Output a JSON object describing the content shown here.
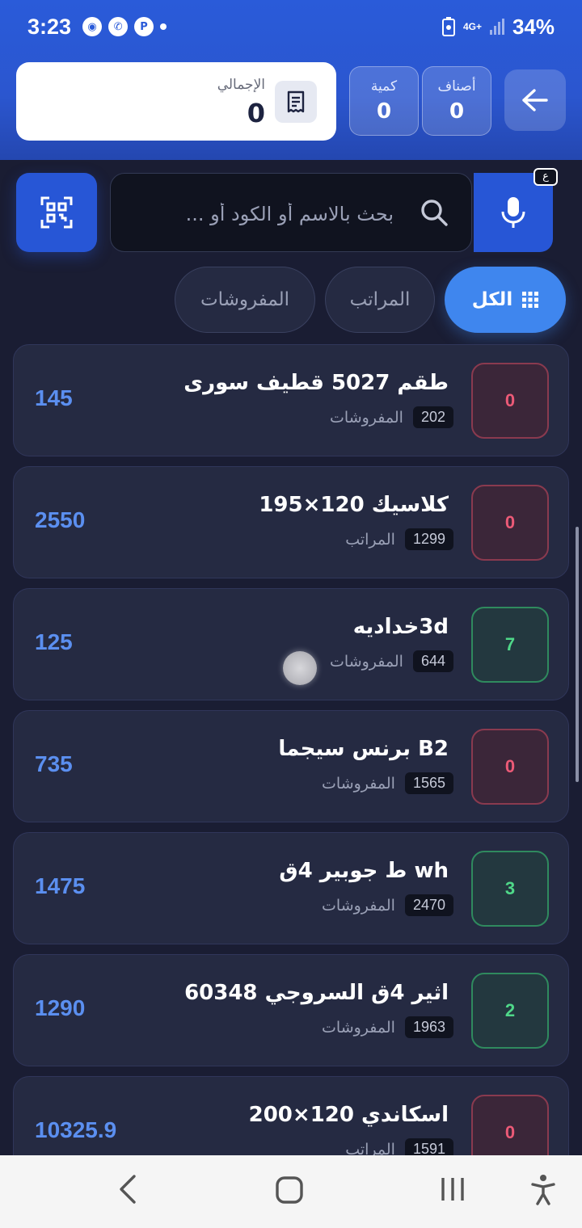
{
  "status_bar": {
    "time": "3:23",
    "network": "4G+",
    "battery": "34%"
  },
  "header": {
    "total_label": "الإجمالي",
    "total_value": "0",
    "quantity_label": "كمية",
    "quantity_value": "0",
    "items_label": "أصناف",
    "items_value": "0"
  },
  "search": {
    "placeholder": "بحث بالاسم أو الكود أو ...",
    "keyboard_badge": "ع"
  },
  "filters": [
    {
      "label": "الكل"
    },
    {
      "label": "المراتب"
    },
    {
      "label": "المفروشات"
    }
  ],
  "products": [
    {
      "name": "طقم 5027 قطيف سورى",
      "code": "202",
      "category": "المفروشات",
      "quantity": "0",
      "price": "145"
    },
    {
      "name": "كلاسيك 120×195",
      "code": "1299",
      "category": "المراتب",
      "quantity": "0",
      "price": "2550"
    },
    {
      "name": "3dخداديه",
      "code": "644",
      "category": "المفروشات",
      "quantity": "7",
      "price": "125"
    },
    {
      "name": "B2 برنس سيجما",
      "code": "1565",
      "category": "المفروشات",
      "quantity": "0",
      "price": "735"
    },
    {
      "name": "wh ط جوبير 4ق",
      "code": "2470",
      "category": "المفروشات",
      "quantity": "3",
      "price": "1475"
    },
    {
      "name": "اثير 4ق السروجي 60348",
      "code": "1963",
      "category": "المفروشات",
      "quantity": "2",
      "price": "1290"
    },
    {
      "name": "اسكاندي 120×200",
      "code": "1591",
      "category": "المراتب",
      "quantity": "0",
      "price": "10325.9"
    }
  ],
  "colors": {
    "accent": "#2756d6",
    "price": "#5b8ff0",
    "qty_zero": "#ec5a77",
    "qty_positive": "#4fd889"
  }
}
